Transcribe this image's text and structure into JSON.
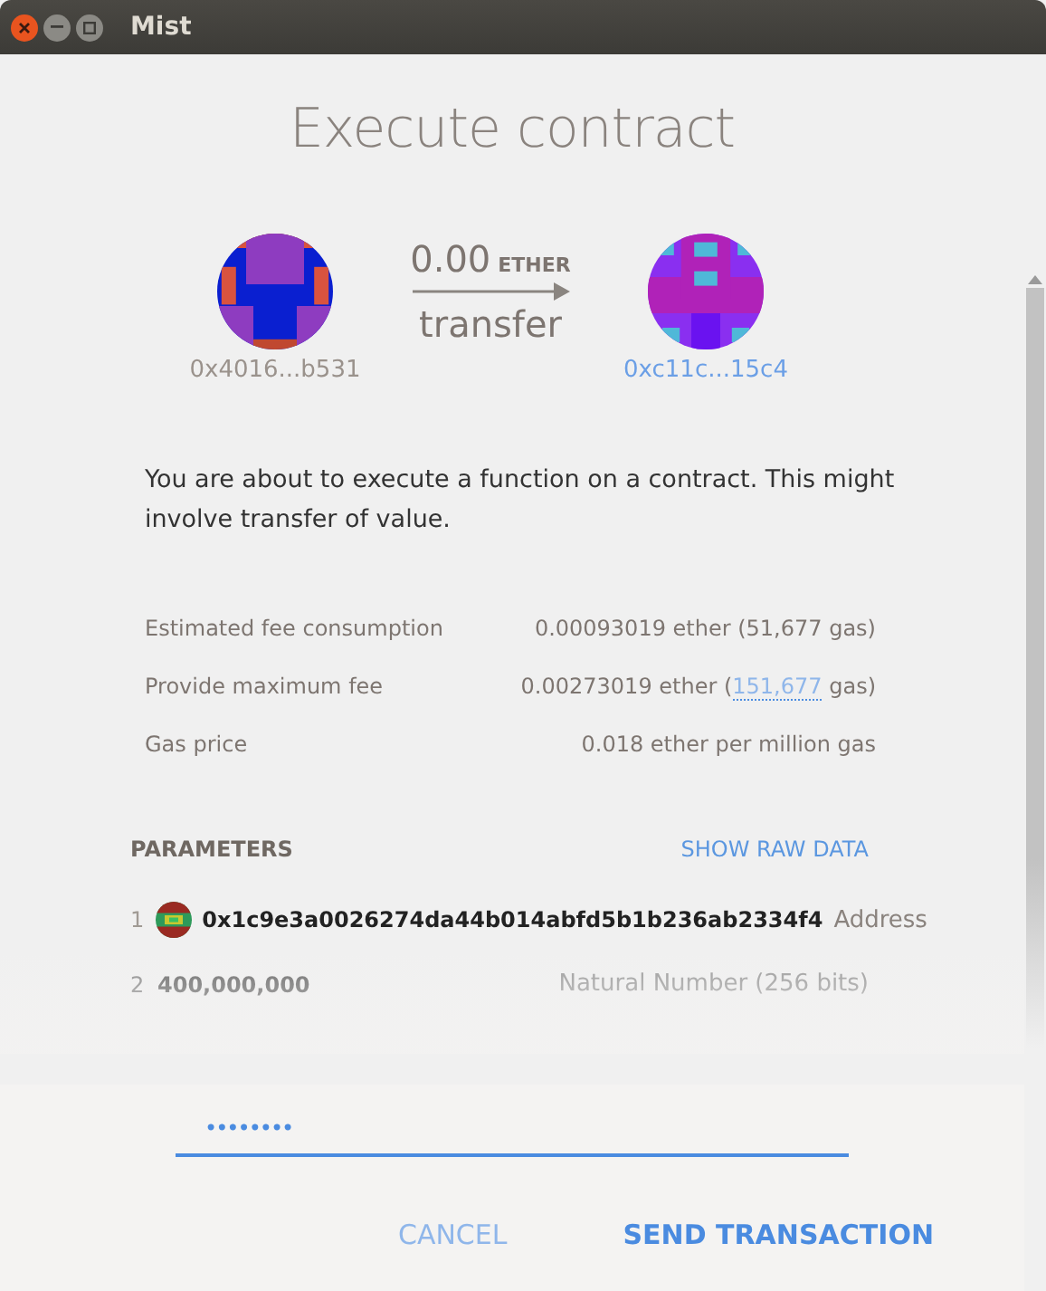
{
  "window": {
    "title": "Mist"
  },
  "dialog": {
    "title": "Execute contract"
  },
  "transfer": {
    "amount": "0.00",
    "unit": "ETHER",
    "action": "transfer",
    "from": "0x4016...b531",
    "to": "0xc11c...15c4"
  },
  "description": "You are about to execute a function on a contract. This might involve transfer of value.",
  "fees": [
    {
      "label": "Estimated fee consumption",
      "value": "0.00093019 ether (51,677 gas)"
    },
    {
      "label": "Provide maximum fee",
      "value_before": "0.00273019 ether (",
      "gas_link": "151,677",
      "value_after": " gas)"
    },
    {
      "label": "Gas price",
      "value": "0.018 ether per million gas"
    }
  ],
  "parameters": {
    "heading": "PARAMETERS",
    "raw_data_link": "SHOW RAW DATA",
    "rows": [
      {
        "index": "1",
        "kind": "address",
        "value": "0x1c9e3a0026274da44b014abfd5b1b236ab2334f4",
        "type": "Address"
      },
      {
        "index": "2",
        "kind": "number",
        "value": "400,000,000",
        "type": "Natural Number (256 bits)"
      }
    ]
  },
  "password": {
    "value": "••••••••"
  },
  "buttons": {
    "cancel": "CANCEL",
    "send": "SEND TRANSACTION"
  }
}
